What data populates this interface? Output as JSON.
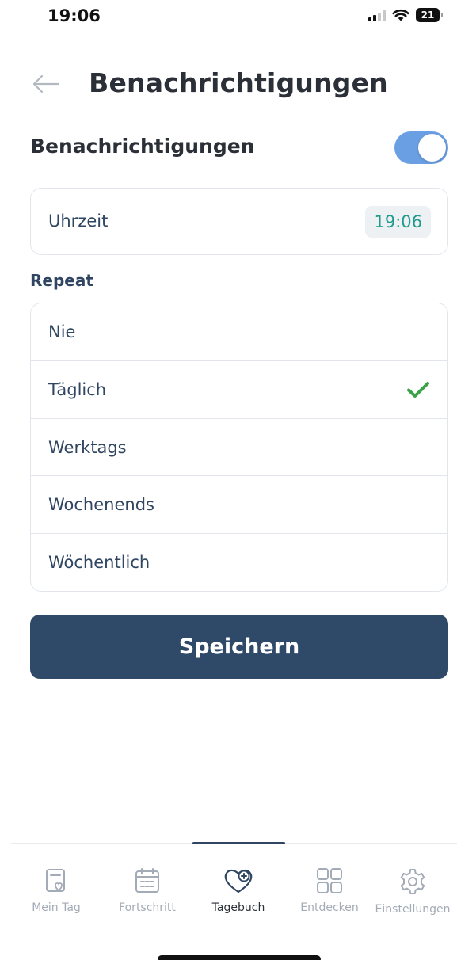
{
  "status_bar": {
    "time": "19:06",
    "battery": "21"
  },
  "header": {
    "title": "Benachrichtigungen",
    "back_icon": "arrow-left-icon"
  },
  "notifications": {
    "label": "Benachrichtigungen",
    "enabled": true,
    "toggle_color": "#6a9fe3"
  },
  "time": {
    "label": "Uhrzeit",
    "value": "19:06",
    "value_color": "#1f9a8c"
  },
  "repeat": {
    "label": "Repeat",
    "options": [
      {
        "label": "Nie",
        "selected": false
      },
      {
        "label": "Täglich",
        "selected": true
      },
      {
        "label": "Werktags",
        "selected": false
      },
      {
        "label": "Wochenends",
        "selected": false
      },
      {
        "label": "Wöchentlich",
        "selected": false
      }
    ],
    "check_color": "#3aa34a"
  },
  "save_button": {
    "label": "Speichern",
    "color": "#2f4a68"
  },
  "bottom_nav": {
    "items": [
      {
        "label": "Mein Tag",
        "icon": "day-card-icon",
        "active": false
      },
      {
        "label": "Fortschritt",
        "icon": "calendar-icon",
        "active": false
      },
      {
        "label": "Tagebuch",
        "icon": "heart-plus-icon",
        "active": true
      },
      {
        "label": "Entdecken",
        "icon": "grid-icon",
        "active": false
      },
      {
        "label": "Einstellungen",
        "icon": "gear-icon",
        "active": false
      }
    ]
  }
}
